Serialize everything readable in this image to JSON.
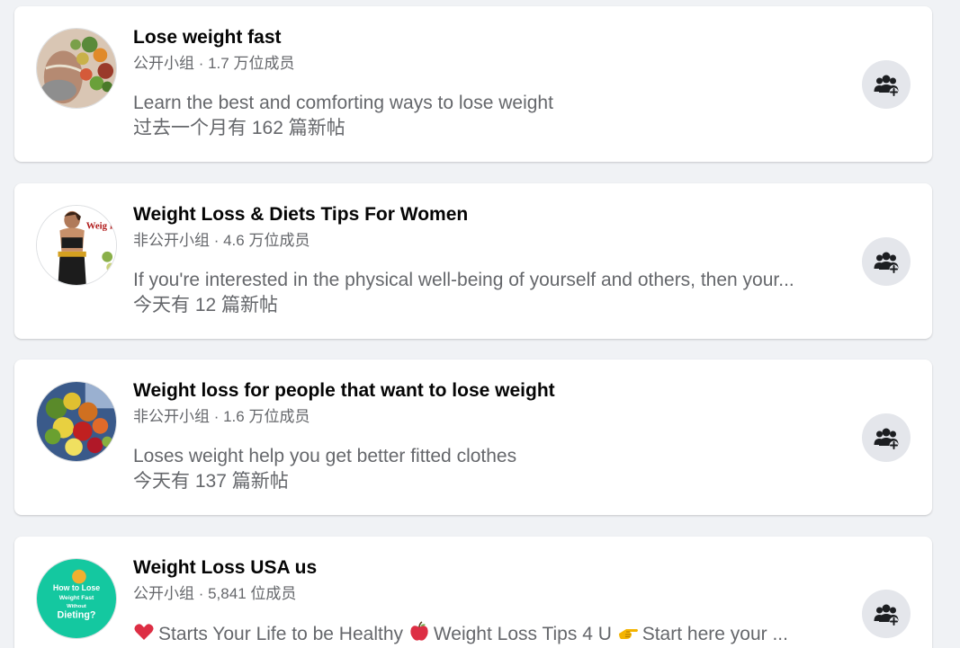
{
  "groups": [
    {
      "title": "Lose weight fast",
      "meta": "公开小组 · 1.7 万位成员",
      "description": "Learn the best and comforting ways to lose weight",
      "posts": "过去一个月有 162 篇新帖",
      "avatar_icon": "healthy-food-avatar",
      "join_icon": "join-group-icon"
    },
    {
      "title": "Weight Loss & Diets Tips For Women",
      "meta": "非公开小组 · 4.6 万位成员",
      "description": "If you're interested in the physical well-being of yourself and others, then your...",
      "posts": "今天有 12 篇新帖",
      "avatar_icon": "woman-measuring-waist-avatar",
      "avatar_text": "Weig Fo",
      "join_icon": "join-group-icon"
    },
    {
      "title": "Weight loss for people that want to lose weight",
      "meta": "非公开小组 · 1.6 万位成员",
      "description": "Loses weight help you get better fitted clothes",
      "posts": "今天有 137 篇新帖",
      "avatar_icon": "fruit-plate-avatar",
      "join_icon": "join-group-icon"
    },
    {
      "title": "Weight Loss USA us",
      "meta": "公开小组 · 5,841 位成员",
      "description_parts": [
        "Starts Your Life to be Healthy ",
        "Weight Loss Tips 4 U ",
        "Start here your ..."
      ],
      "description_icons": [
        "red-heart-icon",
        "red-apple-icon",
        "pointing-hand-icon"
      ],
      "avatar_icon": "how-to-lose-weight-avatar",
      "avatar_text_lines": [
        "How to Lose",
        "Weight Fast",
        "Without",
        "Dieting?"
      ],
      "join_icon": "join-group-icon"
    }
  ],
  "colors": {
    "background": "#f0f2f5",
    "card": "#ffffff",
    "title": "#050505",
    "secondary": "#65676b",
    "button": "#e4e6eb"
  }
}
